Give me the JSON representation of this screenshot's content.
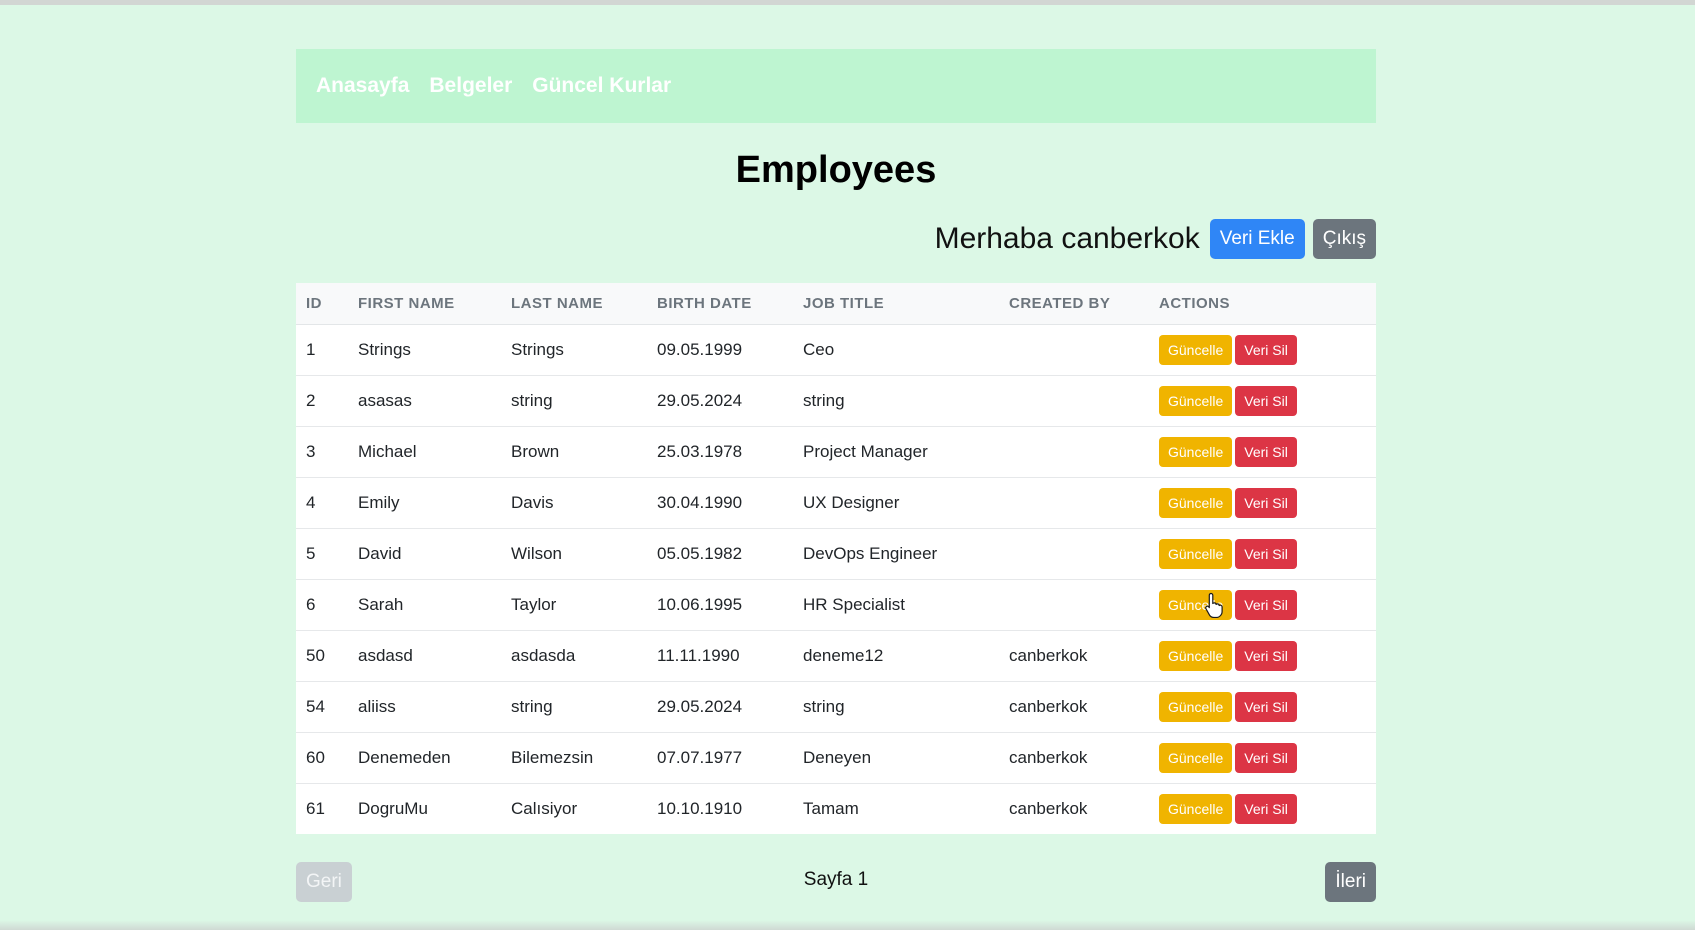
{
  "nav": {
    "items": [
      {
        "label": "Anasayfa"
      },
      {
        "label": "Belgeler"
      },
      {
        "label": "Güncel Kurlar"
      }
    ]
  },
  "page": {
    "title": "Employees",
    "greeting": "Merhaba canberkok",
    "add_button": "Veri Ekle",
    "exit_button": "Çıkış"
  },
  "table": {
    "headers": [
      "ID",
      "FIRST NAME",
      "LAST NAME",
      "BIRTH DATE",
      "JOB TITLE",
      "CREATED BY",
      "ACTIONS"
    ],
    "update_label": "Güncelle",
    "delete_label": "Veri Sil",
    "rows": [
      {
        "id": "1",
        "first": "Strings",
        "last": "Strings",
        "birth": "09.05.1999",
        "job": "Ceo",
        "created_by": ""
      },
      {
        "id": "2",
        "first": "asasas",
        "last": "string",
        "birth": "29.05.2024",
        "job": "string",
        "created_by": ""
      },
      {
        "id": "3",
        "first": "Michael",
        "last": "Brown",
        "birth": "25.03.1978",
        "job": "Project Manager",
        "created_by": ""
      },
      {
        "id": "4",
        "first": "Emily",
        "last": "Davis",
        "birth": "30.04.1990",
        "job": "UX Designer",
        "created_by": ""
      },
      {
        "id": "5",
        "first": "David",
        "last": "Wilson",
        "birth": "05.05.1982",
        "job": "DevOps Engineer",
        "created_by": ""
      },
      {
        "id": "6",
        "first": "Sarah",
        "last": "Taylor",
        "birth": "10.06.1995",
        "job": "HR Specialist",
        "created_by": ""
      },
      {
        "id": "50",
        "first": "asdasd",
        "last": "asdasda",
        "birth": "11.11.1990",
        "job": "deneme12",
        "created_by": "canberkok"
      },
      {
        "id": "54",
        "first": "aliiss",
        "last": "string",
        "birth": "29.05.2024",
        "job": "string",
        "created_by": "canberkok"
      },
      {
        "id": "60",
        "first": "Denemeden",
        "last": "Bilemezsin",
        "birth": "07.07.1977",
        "job": "Deneyen",
        "created_by": "canberkok"
      },
      {
        "id": "61",
        "first": "DogruMu",
        "last": "Calısiyor",
        "birth": "10.10.1910",
        "job": "Tamam",
        "created_by": "canberkok"
      }
    ]
  },
  "pagination": {
    "prev_label": "Geri",
    "page_label": "Sayfa 1",
    "next_label": "İleri"
  },
  "colors": {
    "background": "#dcf8e6",
    "navbar": "#bef5d1",
    "primary": "#2f86f6",
    "secondary": "#6c757d",
    "warning": "#f0b400",
    "danger": "#dc3545"
  },
  "icons": {
    "cursor": "hand-pointer-icon"
  }
}
